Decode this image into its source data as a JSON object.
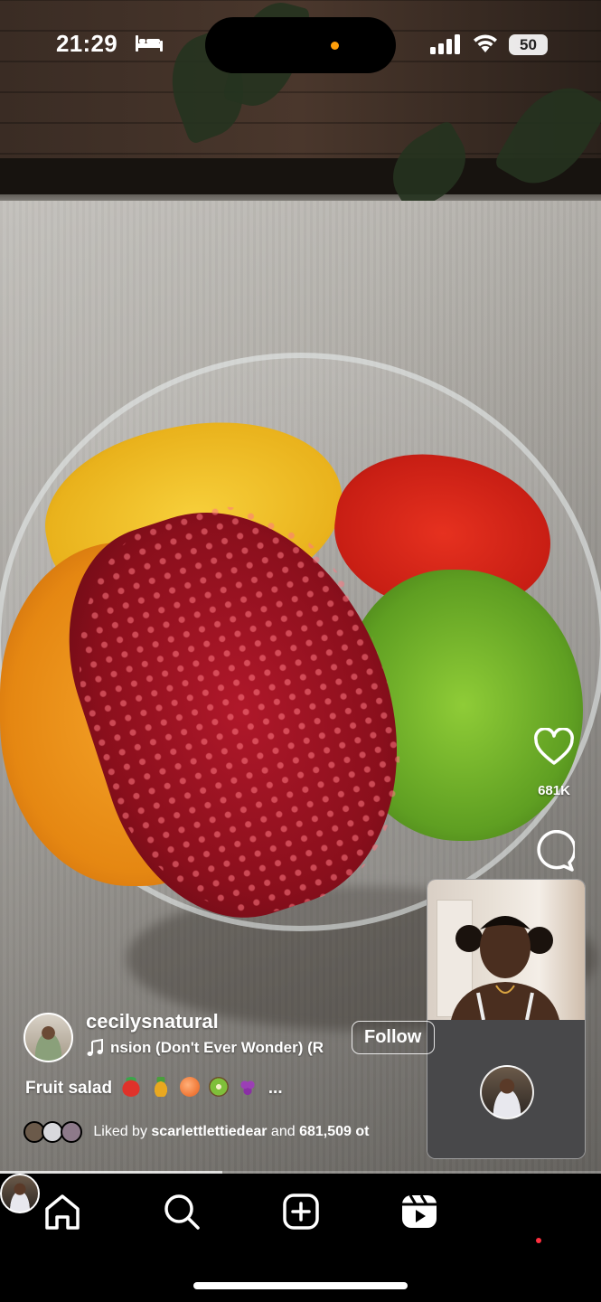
{
  "status_bar": {
    "time": "21:29",
    "battery": "50",
    "icons": [
      "bed-icon",
      "signal-icon",
      "wifi-icon",
      "battery-icon"
    ]
  },
  "reel": {
    "likes": "681K",
    "progress": 0.37,
    "author": {
      "username": "cecilysnatural",
      "follow_label": "Follow"
    },
    "music": {
      "title": "nsion (Don't Ever Wonder) (R"
    },
    "caption": {
      "text": "Fruit salad",
      "emojis": [
        "strawberry",
        "pineapple",
        "peach",
        "kiwi",
        "grapes"
      ],
      "more": "..."
    },
    "liked_by": {
      "prefix": "Liked by",
      "user": "scarlettlettiedear",
      "joiner": "and",
      "count": "681,509 ot"
    }
  },
  "tab_bar": {
    "items": [
      "home-icon",
      "search-icon",
      "create-icon",
      "reels-icon",
      "profile-avatar"
    ]
  },
  "colors": {
    "accent_notification": "#ff3040",
    "island_indicator": "#ff9f0a"
  }
}
